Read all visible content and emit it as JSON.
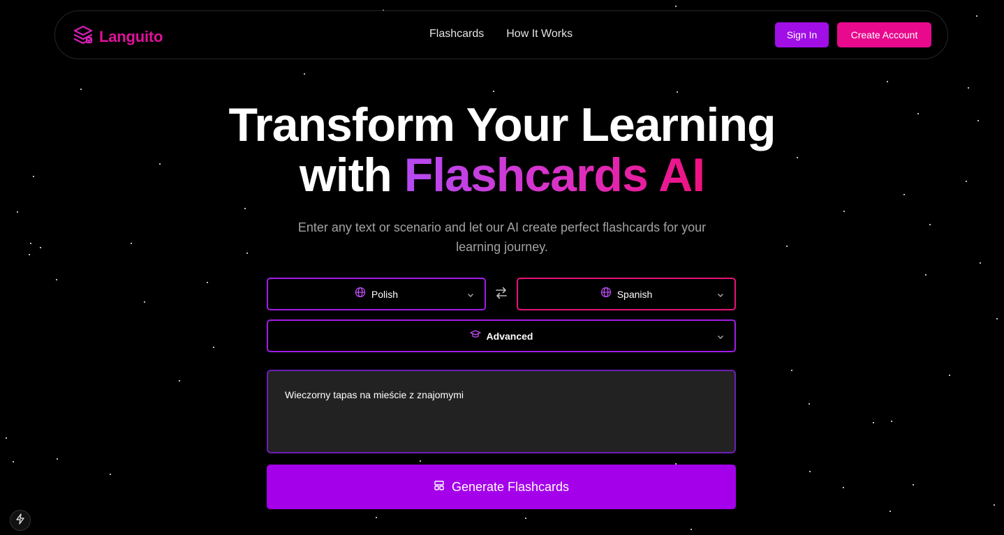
{
  "brand": {
    "name": "Languito",
    "color": "#e0119b"
  },
  "nav": {
    "links": [
      {
        "label": "Flashcards"
      },
      {
        "label": "How It Works"
      }
    ],
    "sign_in": "Sign In",
    "create_account": "Create Account"
  },
  "hero": {
    "title_line1": "Transform Your Learning",
    "title_line2_prefix": "with",
    "title_highlight": "Flashcards AI",
    "subtitle": "Enter any text or scenario and let our AI create perfect flashcards for your learning journey."
  },
  "form": {
    "source_language": "Polish",
    "target_language": "Spanish",
    "level": "Advanced",
    "input_text": "Wieczorny tapas na mieście z znajomymi",
    "generate_label": "Generate Flashcards"
  },
  "icons": {
    "logo": "layers-icon",
    "language": "globe-icon",
    "swap": "swap-arrows-icon",
    "level": "graduation-cap-icon",
    "chevron": "chevron-down-icon",
    "generate": "layout-icon",
    "badge": "lightning-icon"
  },
  "colors": {
    "accent_purple": "#a400ea",
    "accent_pink": "#e8098d",
    "background": "#000000"
  }
}
